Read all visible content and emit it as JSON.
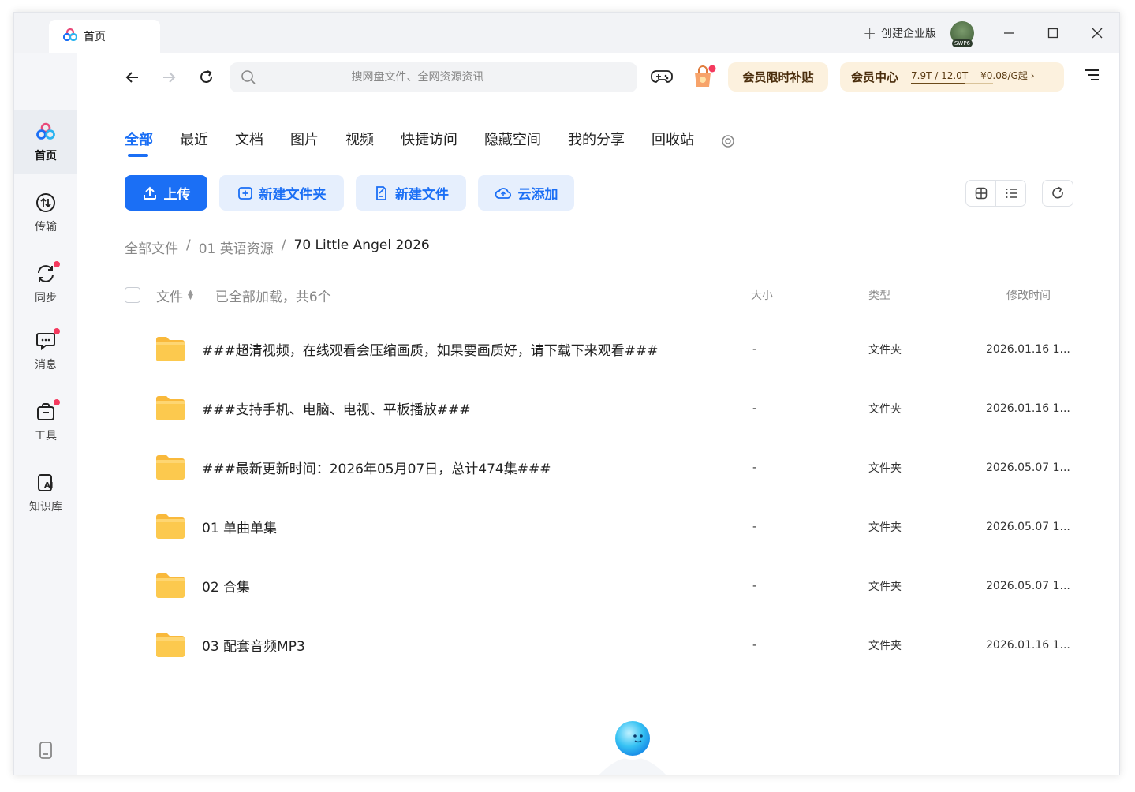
{
  "titlebar": {
    "tab_label": "首页",
    "create_enterprise": "创建企业版",
    "avatar_badge": "SWP6"
  },
  "sidebar": {
    "items": [
      {
        "label": "首页",
        "icon": "baidu-netdisk-logo-icon"
      },
      {
        "label": "传输",
        "icon": "transfer-icon"
      },
      {
        "label": "同步",
        "icon": "sync-icon"
      },
      {
        "label": "消息",
        "icon": "message-icon"
      },
      {
        "label": "工具",
        "icon": "toolbox-icon"
      },
      {
        "label": "知识库",
        "icon": "ai-knowledge-icon"
      }
    ]
  },
  "toolbar": {
    "search_placeholder": "搜网盘文件、全网资源资讯",
    "promo_label": "会员限时补贴",
    "vip_center_label": "会员中心",
    "quota_text": "7.9T / 12.0T",
    "quota_used_fraction": 0.66,
    "price_text": "¥0.08/G起"
  },
  "categories": [
    "全部",
    "最近",
    "文档",
    "图片",
    "视频",
    "快捷访问",
    "隐藏空间",
    "我的分享",
    "回收站"
  ],
  "actions": {
    "upload": "上传",
    "new_folder": "新建文件夹",
    "new_file": "新建文件",
    "cloud_add": "云添加"
  },
  "breadcrumb": {
    "root": "全部文件",
    "level1": "01 英语资源",
    "current": "70 Little Angel 2026"
  },
  "table": {
    "col_file": "文件",
    "loaded_status": "已全部加载，共6个",
    "col_size": "大小",
    "col_type": "类型",
    "col_modified": "修改时间",
    "rows": [
      {
        "name": "###超清视频，在线观看会压缩画质，如果要画质好，请下载下来观看###",
        "size": "-",
        "type": "文件夹",
        "modified": "2026.01.16 1..."
      },
      {
        "name": "###支持手机、电脑、电视、平板播放###",
        "size": "-",
        "type": "文件夹",
        "modified": "2026.01.16 1..."
      },
      {
        "name": "###最新更新时间：2026年05月07日，总计474集###",
        "size": "-",
        "type": "文件夹",
        "modified": "2026.05.07 1..."
      },
      {
        "name": "01 单曲单集",
        "size": "-",
        "type": "文件夹",
        "modified": "2026.05.07 1..."
      },
      {
        "name": "02 合集",
        "size": "-",
        "type": "文件夹",
        "modified": "2026.05.07 1..."
      },
      {
        "name": "03 配套音频MP3",
        "size": "-",
        "type": "文件夹",
        "modified": "2026.01.16 1..."
      }
    ]
  },
  "colors": {
    "accent": "#1b6ff5",
    "accent_light": "#e6effd",
    "promo_bg": "#fcf1de",
    "folder": "#fcc94e",
    "notification_dot": "#f4395e"
  }
}
